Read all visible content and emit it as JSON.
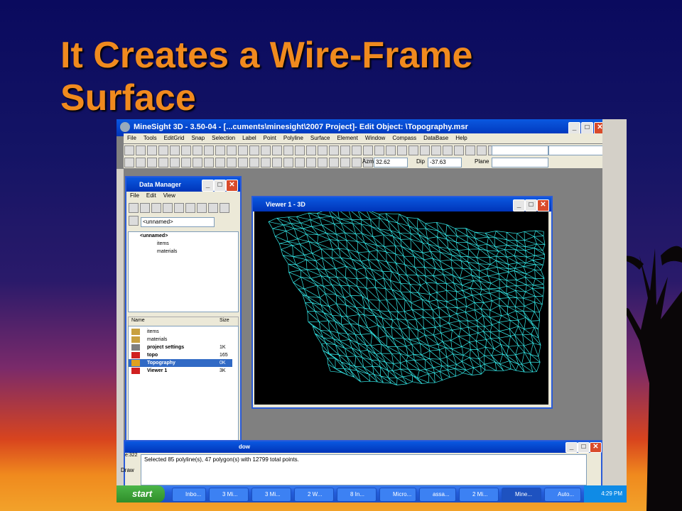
{
  "slide": {
    "title_line1": "It Creates a Wire-Frame",
    "title_line2": "Surface"
  },
  "app": {
    "title": "MineSight 3D  - 3.50-04 - [...cuments\\minesight\\2007 Project]- Edit Object: \\Topography.msr",
    "menu": [
      "File",
      "Tools",
      "EditGrid",
      "Snap",
      "Selection",
      "Label",
      "Point",
      "Polyline",
      "Surface",
      "Element",
      "Window",
      "Compass",
      "DataBase",
      "Help"
    ],
    "azm_label": "Azm",
    "azm_value": "32.62",
    "dip_label": "Dip",
    "dip_value": "-37.63",
    "plane_label": "Plane"
  },
  "data_manager": {
    "title": "Data Manager",
    "menu": [
      "File",
      "Edit",
      "View"
    ],
    "path_value": "<unnamed>",
    "tree": [
      "<unnamed>",
      "items",
      "materials"
    ],
    "columns": {
      "name": "Name",
      "size": "Size"
    },
    "rows": [
      {
        "name": "items",
        "size": "",
        "bold": false,
        "selected": false,
        "color": "#c8a040"
      },
      {
        "name": "materials",
        "size": "",
        "bold": false,
        "selected": false,
        "color": "#c8a040"
      },
      {
        "name": "project settings",
        "size": "1K",
        "bold": true,
        "selected": false,
        "color": "#808080"
      },
      {
        "name": "topo",
        "size": "165",
        "bold": true,
        "selected": false,
        "color": "#d02020"
      },
      {
        "name": "Topography",
        "size": "0K",
        "bold": true,
        "selected": true,
        "color": "#e0a020"
      },
      {
        "name": "Viewer 1",
        "size": "3K",
        "bold": true,
        "selected": false,
        "color": "#d02020"
      }
    ]
  },
  "viewer": {
    "title": "Viewer 1 - 3D",
    "wire_color": "#33e6e6"
  },
  "message_window": {
    "title": "dow",
    "side_label": "e:322",
    "text": "Selected 85 polyline(s), 47 polygon(s) with 12799 total points."
  },
  "draw_label": "Draw",
  "taskbar": {
    "start": "start",
    "tasks": [
      "Inbo...",
      "3 Mi...",
      "3 Mi...",
      "2 W...",
      "8 In...",
      "Micro...",
      "assa...",
      "2 Mi...",
      "Mine...",
      "Auto..."
    ],
    "clock": "4:29 PM"
  }
}
